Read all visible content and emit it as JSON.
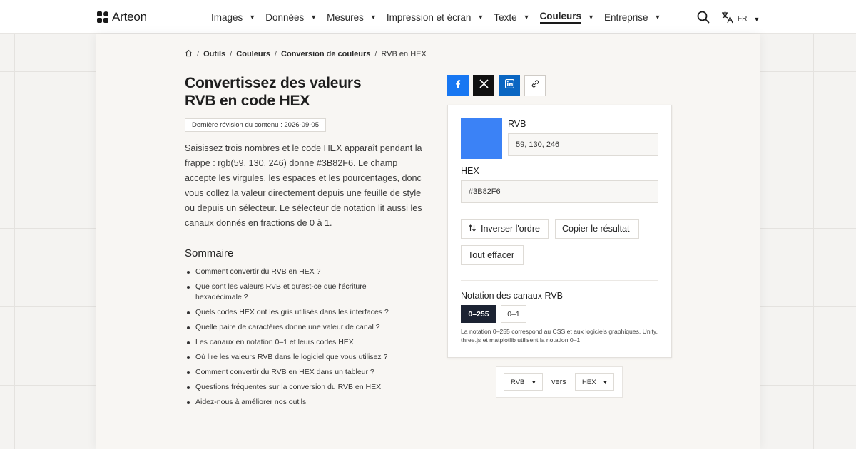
{
  "header": {
    "brand": "Arteon",
    "nav": [
      {
        "label": "Images"
      },
      {
        "label": "Données"
      },
      {
        "label": "Mesures"
      },
      {
        "label": "Impression et écran"
      },
      {
        "label": "Texte"
      },
      {
        "label": "Couleurs",
        "active": true
      },
      {
        "label": "Entreprise"
      }
    ],
    "language": "FR",
    "icons": [
      "search-icon",
      "translate-icon"
    ]
  },
  "breadcrumb": {
    "items": [
      "Outils",
      "Couleurs",
      "Conversion de couleurs"
    ],
    "current": "RVB en HEX"
  },
  "page": {
    "title_line1": "Convertissez des valeurs",
    "title_line2": "RVB en code HEX",
    "revision": "Dernière révision du contenu : 2026-09-05",
    "intro": "Saisissez trois nombres et le code HEX apparaît pendant la frappe : rgb(59, 130, 246) donne #3B82F6. Le champ accepte les virgules, les espaces et les pourcentages, donc vous collez la valeur directement depuis une feuille de style ou depuis un sélecteur. Le sélecteur de notation lit aussi les canaux donnés en fractions de 0 à 1.",
    "toc_title": "Sommaire",
    "toc": [
      "Comment convertir du RVB en HEX ?",
      "Que sont les valeurs RVB et qu'est-ce que l'écriture hexadécimale ?",
      "Quels codes HEX ont les gris utilisés dans les interfaces ?",
      "Quelle paire de caractères donne une valeur de canal ?",
      "Les canaux en notation 0–1 et leurs codes HEX",
      "Où lire les valeurs RVB dans le logiciel que vous utilisez ?",
      "Comment convertir du RVB en HEX dans un tableur ?",
      "Questions fréquentes sur la conversion du RVB en HEX",
      "Aidez-nous à améliorer nos outils"
    ]
  },
  "share": [
    "facebook-icon",
    "x-icon",
    "linkedin-icon",
    "link-icon"
  ],
  "converter": {
    "swatch_color": "#3B82F6",
    "rgb_label": "RVB",
    "rgb_value": "59, 130, 246",
    "hex_label": "HEX",
    "hex_value": "#3B82F6",
    "swap_label": "Inverser l'ordre",
    "copy_label": "Copier le résultat",
    "clear_label": "Tout effacer",
    "notation_label": "Notation des canaux RVB",
    "notation_options": [
      "0–255",
      "0–1"
    ],
    "notation_selected": "0–255",
    "note": "La notation 0–255 correspond au CSS et aux logiciels graphiques. Unity, three.js et matplotlib utilisent la notation 0–1."
  },
  "direction": {
    "from": "RVB",
    "vers": "vers",
    "to": "HEX"
  }
}
